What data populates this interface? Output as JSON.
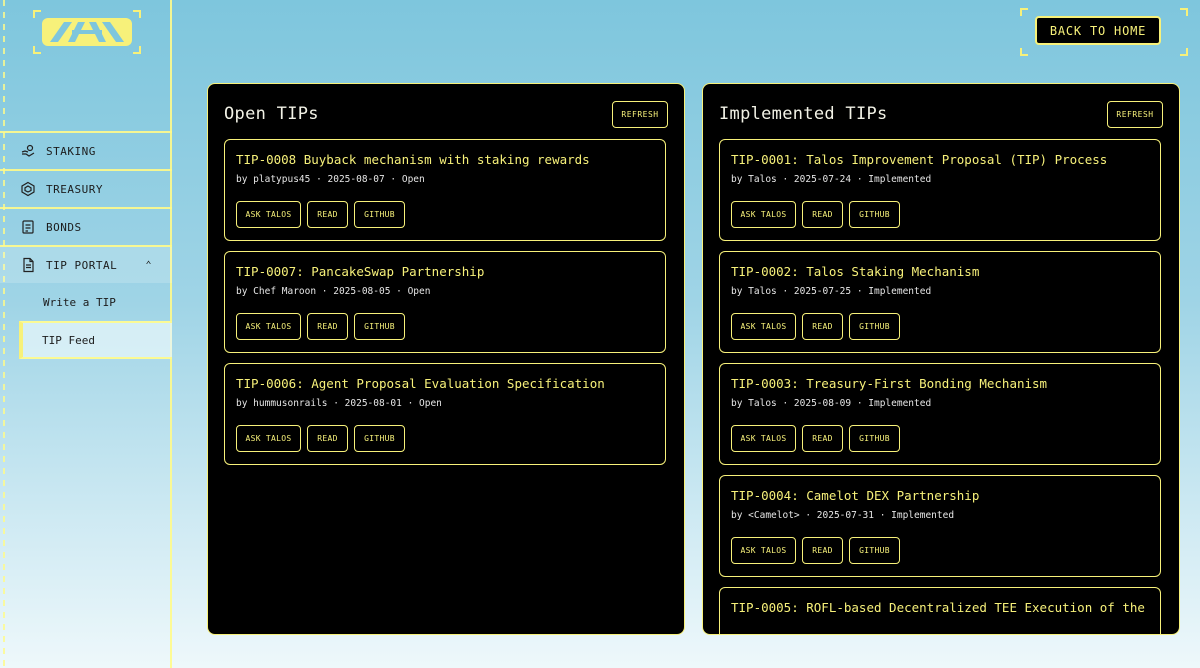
{
  "header": {
    "back_label": "BACK TO HOME"
  },
  "sidebar": {
    "items": [
      {
        "label": "STAKING",
        "icon": "staking-icon"
      },
      {
        "label": "TREASURY",
        "icon": "treasury-icon"
      },
      {
        "label": "BONDS",
        "icon": "bonds-icon"
      },
      {
        "label": "TIP PORTAL",
        "icon": "document-icon"
      }
    ],
    "sub_items": [
      {
        "label": "Write a TIP"
      },
      {
        "label": "TIP Feed"
      }
    ]
  },
  "open_panel": {
    "title": "Open TIPs",
    "refresh_label": "REFRESH",
    "tips": [
      {
        "title": "TIP-0008 Buyback mechanism with staking rewards",
        "meta": "by platypus45 · 2025-08-07 · Open"
      },
      {
        "title": "TIP-0007: PancakeSwap Partnership",
        "meta": "by Chef Maroon · 2025-08-05 · Open"
      },
      {
        "title": "TIP-0006: Agent Proposal Evaluation Specification",
        "meta": "by hummusonrails · 2025-08-01 · Open"
      }
    ]
  },
  "implemented_panel": {
    "title": "Implemented TIPs",
    "refresh_label": "REFRESH",
    "tips": [
      {
        "title": "TIP-0001: Talos Improvement Proposal (TIP) Process",
        "meta": "by Talos · 2025-07-24 · Implemented"
      },
      {
        "title": "TIP-0002: Talos Staking Mechanism",
        "meta": "by Talos · 2025-07-25 · Implemented"
      },
      {
        "title": "TIP-0003: Treasury-First Bonding Mechanism",
        "meta": "by Talos · 2025-08-09 · Implemented"
      },
      {
        "title": "TIP-0004: Camelot DEX Partnership",
        "meta": "by <Camelot> · 2025-07-31 · Implemented"
      },
      {
        "title": "TIP-0005: ROFL-based Decentralized TEE Execution of the",
        "meta": ""
      }
    ]
  },
  "card_actions": {
    "ask": "ASK TALOS",
    "read": "READ",
    "github": "GITHUB"
  },
  "colors": {
    "accent": "#f7f17a",
    "panel_bg": "#000000",
    "page_top": "#7ec6dd",
    "page_bottom": "#eef8fb"
  }
}
